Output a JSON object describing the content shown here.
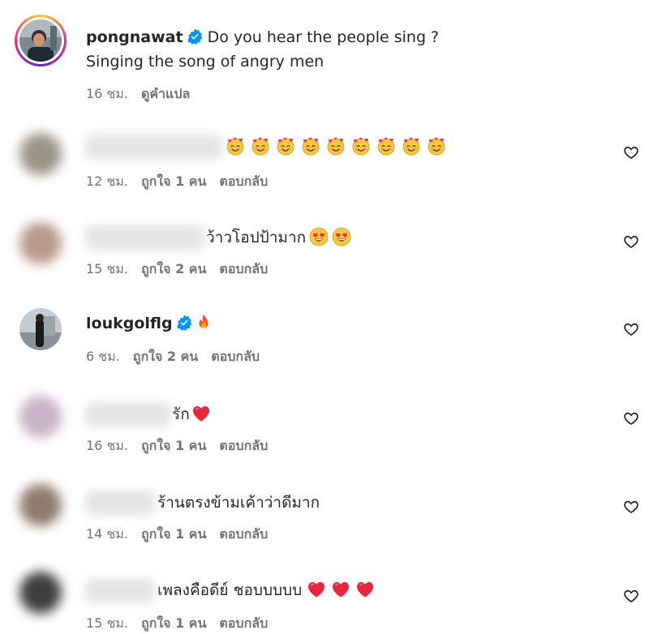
{
  "post": {
    "username": "pongnawat",
    "caption_line1": "Do you hear the people sing ?",
    "caption_line2": "Singing the song of angry men",
    "time": "16 ชม.",
    "translate": "ดูคำแปล"
  },
  "comments": [
    {
      "text": "",
      "emoji": "smiling-face-with-hearts x9",
      "time": "12 ชม.",
      "likes": "ถูกใจ 1 คน",
      "reply": "ตอบกลับ"
    },
    {
      "text": "ว้าวโอปป้ามาก",
      "emoji": "heart-eyes x2",
      "time": "15 ชม.",
      "likes": "ถูกใจ 2 คน",
      "reply": "ตอบกลับ"
    },
    {
      "username": "loukgolflg",
      "emoji": "fire",
      "time": "6 ชม.",
      "likes": "ถูกใจ 2 คน",
      "reply": "ตอบกลับ"
    },
    {
      "text": "รัก",
      "emoji": "red-heart",
      "time": "16 ชม.",
      "likes": "ถูกใจ 1 คน",
      "reply": "ตอบกลับ"
    },
    {
      "text": "ร้านตรงข้ามเค้าว่าดีมาก",
      "time": "14 ชม.",
      "likes": "ถูกใจ 1 คน",
      "reply": "ตอบกลับ"
    },
    {
      "text": "เพลงคือดีย์ ชอบบบบบ",
      "emoji": "red-heart x3",
      "time": "15 ชม.",
      "likes": "ถูกใจ 1 คน",
      "reply": "ตอบกลับ"
    }
  ],
  "colors": {
    "text": "#262626",
    "meta": "#737373",
    "verified": "#0095f6",
    "heart": "#262626"
  },
  "icons": [
    "verified-badge-icon",
    "heart-outline-icon",
    "smiling-face-with-hearts-emoji",
    "heart-eyes-emoji",
    "fire-emoji",
    "red-heart-emoji"
  ]
}
